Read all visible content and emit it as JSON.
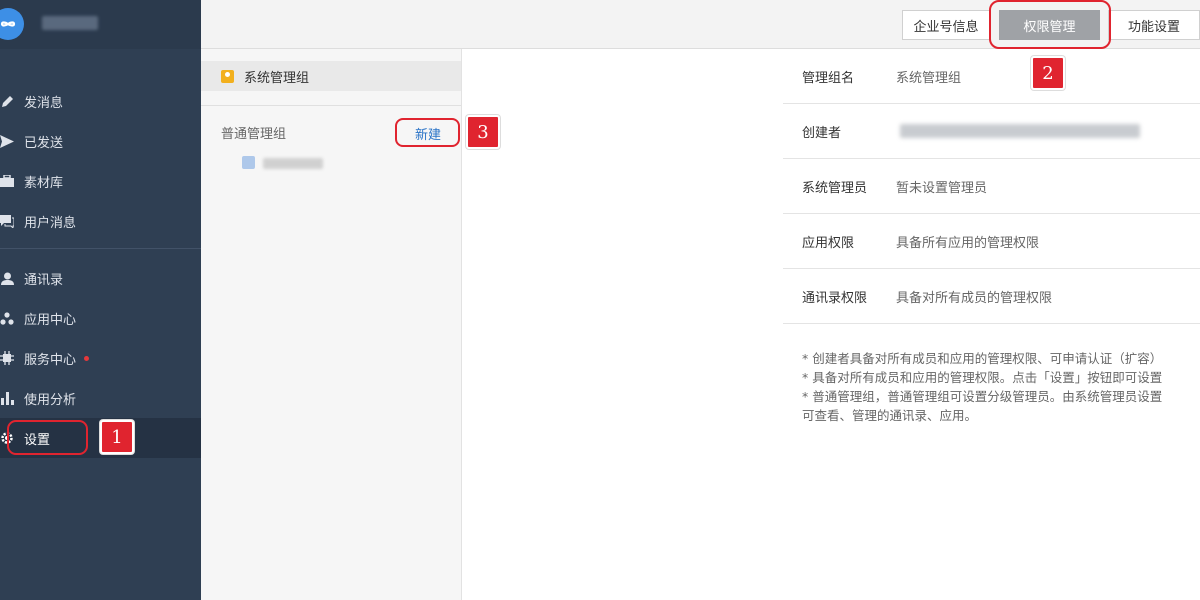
{
  "sidebar": {
    "brand_name": "鸿泰微电",
    "items": [
      {
        "label": "发消息",
        "icon": "pencil-icon"
      },
      {
        "label": "已发送",
        "icon": "send-icon"
      },
      {
        "label": "素材库",
        "icon": "briefcase-icon"
      },
      {
        "label": "用户消息",
        "icon": "chat-icon"
      },
      {
        "label": "通讯录",
        "icon": "person-icon"
      },
      {
        "label": "应用中心",
        "icon": "apps-icon"
      },
      {
        "label": "服务中心",
        "icon": "chip-icon"
      },
      {
        "label": "使用分析",
        "icon": "bar-chart-icon"
      },
      {
        "label": "设置",
        "icon": "gear-icon"
      }
    ],
    "active_item": "设置"
  },
  "topbar": {
    "tabs": [
      {
        "label": "企业号信息"
      },
      {
        "label": "权限管理"
      },
      {
        "label": "功能设置"
      }
    ],
    "active_tab": "权限管理"
  },
  "groups": {
    "system_group_label": "系统管理组",
    "normal_group_label": "普通管理组",
    "new_button_label": "新建",
    "sub_group_name": "鸿泰微电"
  },
  "detail": {
    "rows": [
      {
        "label": "管理组名",
        "value": "系统管理组"
      },
      {
        "label": "创建者",
        "value": ""
      },
      {
        "label": "系统管理员",
        "value": "暂未设置管理员"
      },
      {
        "label": "应用权限",
        "value": "具备所有应用的管理权限"
      },
      {
        "label": "通讯录权限",
        "value": "具备对所有成员的管理权限"
      }
    ],
    "notes": [
      "* 创建者具备对所有成员和应用的管理权限、可申请认证（扩容）",
      "* 具备对所有成员和应用的管理权限。点击「设置」按钮即可设置",
      "* 普通管理组，普通管理组可设置分级管理员。由系统管理员设置",
      "可查看、管理的通讯录、应用。"
    ]
  },
  "annotations": [
    "1",
    "2",
    "3"
  ],
  "colors": {
    "sidebar_bg": "#2f3f53",
    "accent_red": "#e0242f",
    "link_blue": "#2b74c7",
    "active_tab_bg": "#9fa2a6"
  }
}
